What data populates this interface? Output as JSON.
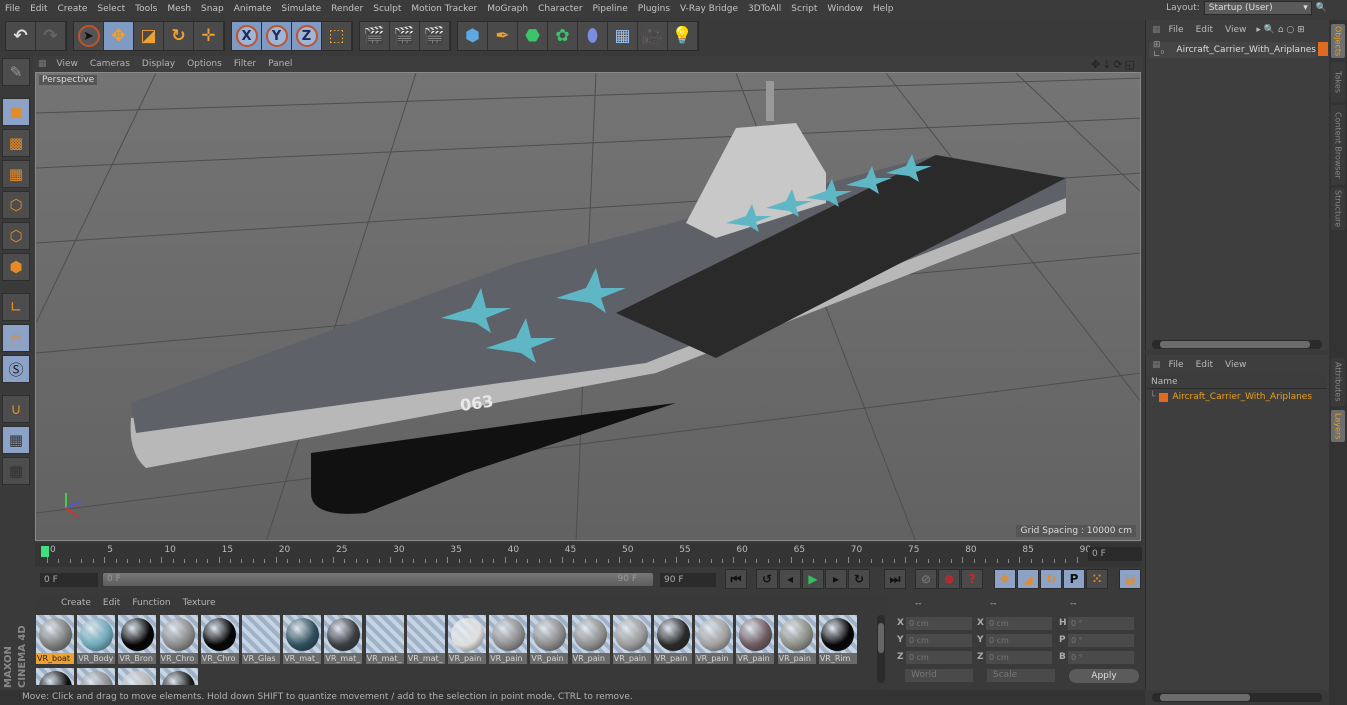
{
  "menubar": {
    "items": [
      "File",
      "Edit",
      "Create",
      "Select",
      "Tools",
      "Mesh",
      "Snap",
      "Animate",
      "Simulate",
      "Render",
      "Sculpt",
      "Motion Tracker",
      "MoGraph",
      "Character",
      "Pipeline",
      "Plugins",
      "V-Ray Bridge",
      "3DToAll",
      "Script",
      "Window",
      "Help"
    ],
    "layout_label": "Layout:",
    "layout_value": "Startup (User)"
  },
  "toolbar": {
    "groups": [
      [
        "undo-icon",
        "redo-icon"
      ],
      [
        "live-selection-icon",
        "move-icon",
        "scale-icon",
        "rotate-icon",
        "recent-tool-icon"
      ],
      [
        "x-axis-icon",
        "y-axis-icon",
        "z-axis-icon",
        "coordinate-system-icon"
      ],
      [
        "render-view-icon",
        "render-picture-viewer-icon",
        "render-settings-icon"
      ],
      [
        "cube-icon",
        "pen-icon",
        "subdivision-icon",
        "cloner-icon",
        "deformer-icon",
        "floor-icon",
        "camera-icon",
        "light-icon"
      ]
    ],
    "axis_labels": [
      "X",
      "Y",
      "Z"
    ]
  },
  "left_tools": [
    "make-editable",
    "model-mode",
    "texture-mode",
    "workplane-mode",
    "points-mode",
    "edges-mode",
    "polygons-mode",
    "axis-mode",
    "tweak-mode",
    "solo-mode",
    "snap-mode",
    "lock-workplane",
    "workplane-planar"
  ],
  "viewport": {
    "menu": [
      "View",
      "Cameras",
      "Display",
      "Options",
      "Filter",
      "Panel"
    ],
    "camera_label": "Perspective",
    "grid_spacing": "Grid Spacing : 10000 cm",
    "hull_number": "063"
  },
  "timeline": {
    "ticks": [
      "0",
      "5",
      "10",
      "15",
      "20",
      "25",
      "30",
      "35",
      "40",
      "45",
      "50",
      "55",
      "60",
      "65",
      "70",
      "75",
      "80",
      "85",
      "90"
    ],
    "current_frame_field": "0 F",
    "start_field": "0 F",
    "range_start": "0 F",
    "range_end": "90 F",
    "end_field": "90 F"
  },
  "playback": {
    "buttons": [
      "go-to-start",
      "previous-key",
      "previous-frame",
      "play",
      "next-frame",
      "next-key",
      "go-to-end"
    ],
    "record_buttons": [
      "record-active-objects",
      "autokey",
      "keyframe-selection"
    ],
    "key_buttons": [
      "position-key",
      "scale-key",
      "rotation-key",
      "parameter-key",
      "point-level-animation",
      "timeline-window"
    ],
    "param_label": "P"
  },
  "materials": {
    "menu": [
      "Create",
      "Edit",
      "Function",
      "Texture"
    ],
    "row1": [
      {
        "label": "VR_boat",
        "color": "#7d7f7c",
        "selected": true
      },
      {
        "label": "VR_Body",
        "color": "#6ea8b8"
      },
      {
        "label": "VR_Bron",
        "color": "#050505"
      },
      {
        "label": "VR_Chro",
        "color": "#8a8a8a"
      },
      {
        "label": "VR_Chro",
        "color": "#050505"
      },
      {
        "label": "VR_Glas",
        "color": "transparent"
      },
      {
        "label": "VR_mat_",
        "color": "#2f4f5c"
      },
      {
        "label": "VR_mat_",
        "color": "#3b3f42"
      },
      {
        "label": "VR_mat_",
        "color": "transparent"
      },
      {
        "label": "VR_mat_",
        "color": "transparent"
      },
      {
        "label": "VR_pain",
        "color": "#dedede"
      },
      {
        "label": "VR_pain",
        "color": "#8d8d8d"
      },
      {
        "label": "VR_pain",
        "color": "#8a8a8a"
      },
      {
        "label": "VR_pain",
        "color": "#8f8f8f"
      },
      {
        "label": "VR_pain",
        "color": "#9a9a9a"
      },
      {
        "label": "VR_pain",
        "color": "#2a2a2a"
      },
      {
        "label": "VR_pain",
        "color": "#a0a0a0"
      },
      {
        "label": "VR_pain",
        "color": "#6e5a5f"
      },
      {
        "label": "VR_pain",
        "color": "#8c8f86"
      },
      {
        "label": "VR_Rim",
        "color": "#050505"
      }
    ],
    "row2": [
      {
        "color": "#0d0d0d"
      },
      {
        "color": "#8a8a8a"
      },
      {
        "color": "#b5b5b5"
      },
      {
        "color": "#1a1a1a"
      }
    ]
  },
  "coordinates": {
    "header": [
      "--",
      "--",
      "--"
    ],
    "rows": [
      {
        "l1": "X",
        "v1": "0 cm",
        "l2": "X",
        "v2": "0 cm",
        "l3": "H",
        "v3": "0 °"
      },
      {
        "l1": "Y",
        "v1": "0 cm",
        "l2": "Y",
        "v2": "0 cm",
        "l3": "P",
        "v3": "0 °"
      },
      {
        "l1": "Z",
        "v1": "0 cm",
        "l2": "Z",
        "v2": "0 cm",
        "l3": "B",
        "v3": "0 °"
      }
    ],
    "mode_dropdown": "World",
    "size_dropdown": "Scale",
    "apply_label": "Apply"
  },
  "status": "Move: Click and drag to move elements. Hold down SHIFT to quantize movement / add to the selection in point mode, CTRL to remove.",
  "objects_panel": {
    "menu": [
      "File",
      "Edit",
      "View"
    ],
    "object_name": "Aircraft_Carrier_With_Ariplanes",
    "tag_color": "#e06b20"
  },
  "layers_panel": {
    "menu": [
      "File",
      "Edit",
      "View"
    ],
    "column_header": "Name",
    "layer_name": "Aircraft_Carrier_With_Ariplanes",
    "layer_color": "#e06b20"
  },
  "right_tabs": {
    "top": [
      {
        "label": "Objects",
        "active": true
      },
      {
        "label": "Takes"
      },
      {
        "label": "Content Browser"
      },
      {
        "label": "Structure"
      }
    ],
    "bottom": [
      {
        "label": "Attributes"
      },
      {
        "label": "Layers",
        "active": true
      }
    ]
  },
  "branding": "MAXON CINEMA 4D"
}
